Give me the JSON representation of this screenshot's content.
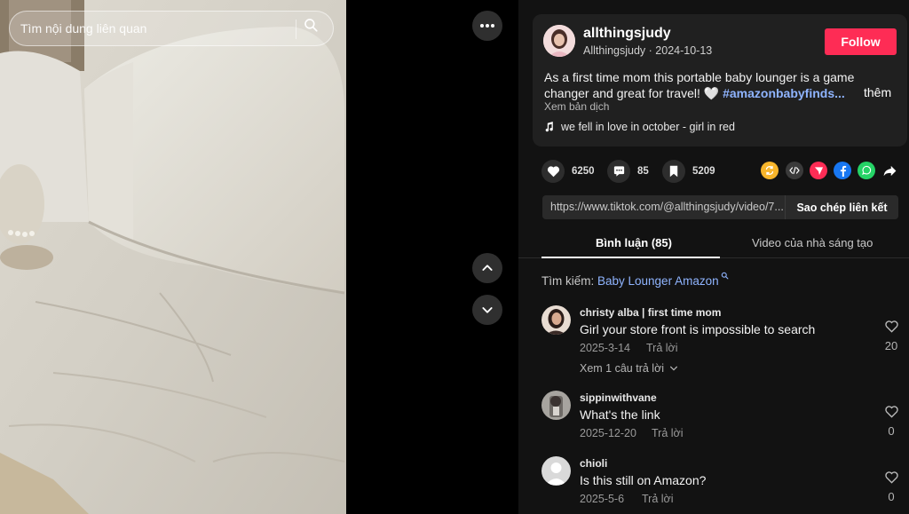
{
  "video": {
    "search_placeholder": "Tìm nội dung liên quan",
    "search_icon": "search-icon"
  },
  "controls": {
    "more_icon": "more-horizontal-icon",
    "up_icon": "chevron-up-icon",
    "down_icon": "chevron-down-icon"
  },
  "author": {
    "name": "allthingsjudy",
    "handle": "Allthingsjudy",
    "separator": " · ",
    "date": "2024-10-13",
    "follow_label": "Follow",
    "description": "As a first time mom this portable baby lounger is a game changer and great for travel! 🤍 ",
    "hashtag": "#amazonbabyfinds...",
    "more_label": "thêm",
    "translate_label": "Xem bản dịch",
    "music": "we fell in love in october - girl in red"
  },
  "stats": {
    "likes": "6250",
    "comments": "85",
    "saves": "5209"
  },
  "share": [
    "repost-icon",
    "embed-icon",
    "send-icon",
    "facebook-icon",
    "whatsapp-icon",
    "share-arrow-icon"
  ],
  "link": {
    "url": "https://www.tiktok.com/@allthingsjudy/video/7...",
    "copy_label": "Sao chép liên kết"
  },
  "tabs": {
    "comments": "Bình luận (85)",
    "creator_videos": "Video của nhà sáng tạo"
  },
  "related_search": {
    "prefix": "Tìm kiếm: ",
    "query": "Baby Lounger Amazon"
  },
  "comments": [
    {
      "user": "christy alba | first time mom",
      "text": "Girl your store front is impossible to search",
      "date": "2025-3-14",
      "reply_label": "Trả lời",
      "likes": "20",
      "view_replies": "Xem 1 câu trả lời"
    },
    {
      "user": "sippinwithvane",
      "text": "What's the link",
      "date": "2025-12-20",
      "reply_label": "Trả lời",
      "likes": "0"
    },
    {
      "user": "chioli",
      "text": "Is this still on Amazon?",
      "date": "2025-5-6",
      "reply_label": "Trả lời",
      "likes": "0"
    }
  ],
  "colors": {
    "follow": "#fe2c55",
    "hashtag": "#8fb4ff",
    "panel_bg": "#121212",
    "card_bg": "#202020"
  }
}
